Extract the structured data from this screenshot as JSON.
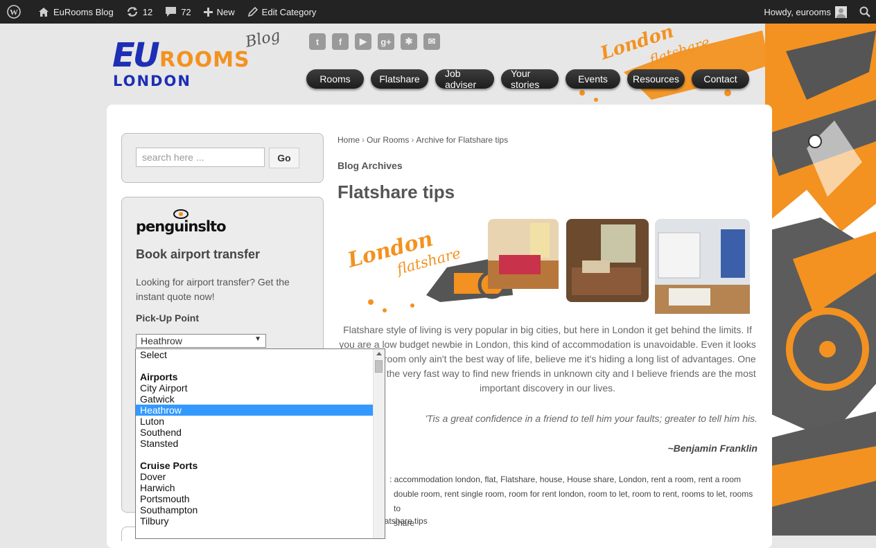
{
  "admin_bar": {
    "site_name": "EuRooms Blog",
    "updates_count": "12",
    "comments_count": "72",
    "new_label": "New",
    "edit_label": "Edit Category",
    "greeting": "Howdy, eurooms"
  },
  "logo": {
    "line1": "EURooms",
    "blog": "Blog",
    "city": "LONDON"
  },
  "socials": [
    "twitter-icon",
    "facebook-icon",
    "youtube-icon",
    "google-plus-icon",
    "yelp-icon",
    "mail-icon"
  ],
  "nav": [
    "Rooms",
    "Flatshare",
    "Job adviser",
    "Your stories",
    "Events",
    "Resources",
    "Contact"
  ],
  "search": {
    "placeholder": "search here ...",
    "button": "Go"
  },
  "transfer": {
    "brand": "penguinslto",
    "title": "Book airport transfer",
    "description": "Looking for airport transfer? Get the instant quote now!",
    "label": "Pick-Up Point",
    "selected": "Heathrow"
  },
  "dropdown": {
    "options": [
      {
        "text": "Select",
        "type": "option"
      },
      {
        "text": "",
        "type": "spacer"
      },
      {
        "text": "Airports",
        "type": "group"
      },
      {
        "text": "City Airport",
        "type": "option"
      },
      {
        "text": "Gatwick",
        "type": "option"
      },
      {
        "text": "Heathrow",
        "type": "option",
        "selected": true
      },
      {
        "text": "Luton",
        "type": "option"
      },
      {
        "text": "Southend",
        "type": "option"
      },
      {
        "text": "Stansted",
        "type": "option"
      },
      {
        "text": "",
        "type": "spacer"
      },
      {
        "text": "Cruise Ports",
        "type": "group"
      },
      {
        "text": "Dover",
        "type": "option"
      },
      {
        "text": "Harwich",
        "type": "option"
      },
      {
        "text": "Portsmouth",
        "type": "option"
      },
      {
        "text": "Southampton",
        "type": "option"
      },
      {
        "text": "Tilbury",
        "type": "option"
      }
    ]
  },
  "breadcrumb": {
    "home": "Home",
    "rooms": "Our Rooms",
    "current": "Archive for Flatshare tips",
    "sep": "›"
  },
  "archive_label": "Blog Archives",
  "page_title": "Flatshare tips",
  "banner": {
    "text1": "London",
    "text2": "flatshare"
  },
  "body": "Flatshare style of living is very popular in big cities, but here in London it get behind the limits. If you are a low budget newbie in London, this kind of accommodation is unavoidable. Even it looks like rent a room only ain't the best way of life, believe me it's hiding a long list of advantages. One of them is, the very fast way to find new friends in unknown city and I believe friends are the most important discovery in our lives.",
  "quote": "'Tis a great confidence in a friend to tell him your faults; greater to tell him his.",
  "author": "~Benjamin Franklin",
  "tags_line1": ": accommodation london, flat, Flatshare, house, House share, London, rent a room, rent a room",
  "tags_line2": "double room, rent single room, room for rent london, room to let, room to rent, rooms to let, rooms to",
  "tags_line3": "share",
  "category": "latshare tips",
  "colors": {
    "accent": "#f39220",
    "admin_bar": "#232323",
    "nav": "#2a2a2a",
    "logo_blue": "#1c2fb5"
  }
}
